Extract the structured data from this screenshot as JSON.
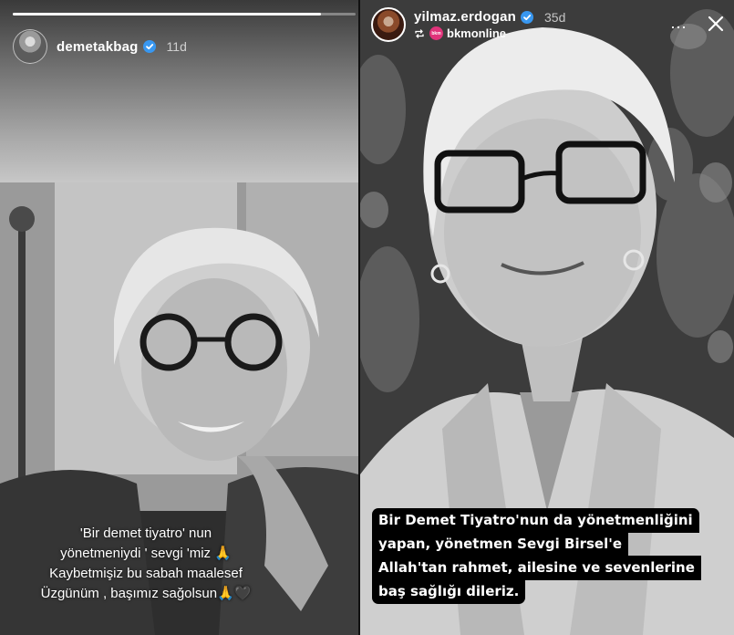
{
  "left_story": {
    "username": "demetakbag",
    "verified": true,
    "time_ago": "11d",
    "progress": 0.9,
    "caption_lines": [
      "'Bir demet tiyatro' nun",
      "yönetmeniydi ' sevgi 'miz 🙏",
      "Kaybetmişiz bu sabah maalesef",
      "Üzgünüm , başımız sağolsun🙏🖤"
    ]
  },
  "right_story": {
    "username": "yilmaz.erdogan",
    "verified": true,
    "time_ago": "35d",
    "reposted_from": "bkmonline",
    "more_icon": "⋯",
    "caption_lines": [
      "Bir Demet Tiyatro'nun da yönetmenliğini",
      "yapan, yönetmen Sevgi Birsel'e",
      "Allah'tan rahmet, ailesine ve sevenlerine",
      "baş sağlığı dileriz."
    ]
  },
  "colors": {
    "verified_badge": "#3897f0",
    "text": "#ffffff",
    "caption_bg": "#000000",
    "repost_avatar": "#e0337a"
  },
  "icons": [
    "verified-badge-icon",
    "repost-icon",
    "more-options-icon",
    "close-icon"
  ]
}
